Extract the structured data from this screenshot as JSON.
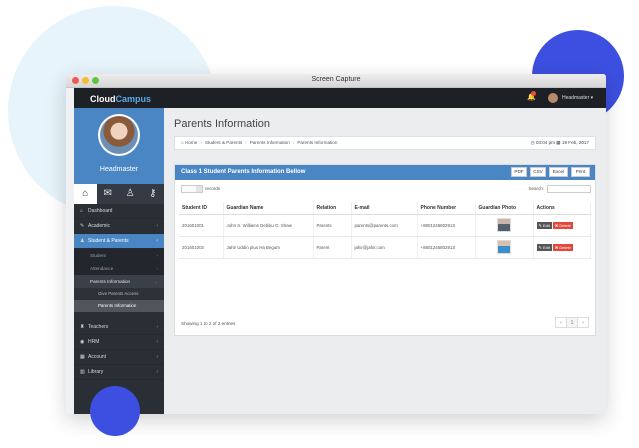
{
  "window": {
    "title": "Screen Capture"
  },
  "nav": {
    "brand_1": "Cloud",
    "brand_2": "Campus",
    "user": "Headmaster"
  },
  "profile": {
    "name": "Headmaster"
  },
  "sidebar": {
    "items": [
      {
        "label": "Dashboard",
        "icon": "dashboard-icon"
      },
      {
        "label": "Academic",
        "icon": "academic-icon"
      },
      {
        "label": "Student & Parents",
        "icon": "student-icon"
      },
      {
        "label": "Teachers",
        "icon": "teachers-icon"
      },
      {
        "label": "HRM",
        "icon": "hrm-icon"
      },
      {
        "label": "Account",
        "icon": "account-icon"
      },
      {
        "label": "Library",
        "icon": "library-icon"
      }
    ],
    "sub": [
      {
        "label": "Student"
      },
      {
        "label": "Attendance"
      },
      {
        "label": "Parents Information"
      }
    ],
    "subsub": [
      {
        "label": "Give Parents Access"
      },
      {
        "label": "Parents Information"
      }
    ]
  },
  "page": {
    "title": "Parents Information",
    "breadcrumb": [
      "Home",
      "Student & Parents",
      "Parents Information",
      "Parents Information"
    ],
    "time": "03:04 pm",
    "date": "19 Feb, 2017"
  },
  "panel": {
    "title": "Class 1 Student Parents Information Bellow",
    "export_buttons": [
      "PDF",
      "CSV",
      "Excel",
      "Print"
    ],
    "records_label": "records",
    "search_label": "Search:"
  },
  "table": {
    "headers": [
      "Student ID",
      "Guardian Name",
      "Relation",
      "E-mail",
      "Phone Number",
      "Guardian Photo",
      "Actions"
    ],
    "rows": [
      {
        "id": "201601001",
        "name": "John S. Williams Debiku O. Shaw",
        "relation": "Parents",
        "email": "parents@parents.com",
        "phone": "+880124580291S",
        "edit": "Edit",
        "delete": "Delete"
      },
      {
        "id": "201601002",
        "name": "Jahir Uddin plus Ha Begum",
        "relation": "Parent",
        "email": "jahir@jahir.com",
        "phone": "+880124580291S",
        "edit": "Edit",
        "delete": "Delete"
      }
    ],
    "footer": "Showing 1 to 2 of 2 entries",
    "pager": [
      "‹",
      "1",
      "›"
    ]
  }
}
